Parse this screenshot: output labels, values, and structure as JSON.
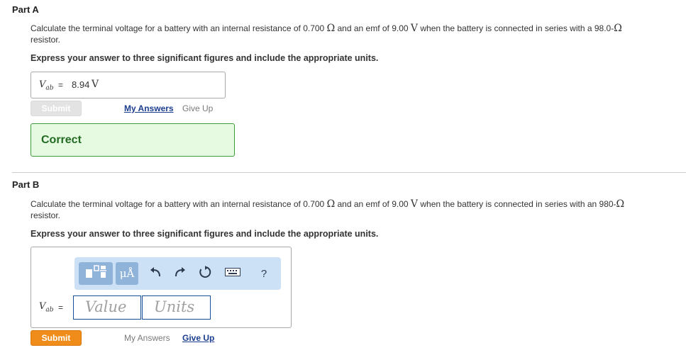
{
  "partA": {
    "title": "Part A",
    "question_pre": "Calculate the terminal voltage for a battery with an internal resistance of 0.700 ",
    "question_unit1": "Ω",
    "question_mid": " and an emf of 9.00 ",
    "question_unit2": "V",
    "question_post": " when the battery is connected in series with a 98.0-",
    "question_unit3": "Ω",
    "question_line2": "resistor.",
    "instruction": "Express your answer to three significant figures and include the appropriate units.",
    "variable": "V",
    "variable_sub": "ab",
    "equals": "=",
    "answer_value": "8.94",
    "answer_unit": "V",
    "submit_label": "Submit",
    "my_answers_label": "My Answers",
    "give_up_label": "Give Up",
    "feedback": "Correct"
  },
  "partB": {
    "title": "Part B",
    "question_pre": "Calculate the terminal voltage for a battery with an internal resistance of 0.700 ",
    "question_unit1": "Ω",
    "question_mid": " and an emf of 9.00 ",
    "question_unit2": "V",
    "question_post": " when the battery is connected in series with an 980-",
    "question_unit3": "Ω",
    "question_line2": "resistor.",
    "instruction": "Express your answer to three significant figures and include the appropriate units.",
    "toolbar": {
      "units_label": "μÅ",
      "help_label": "?"
    },
    "variable": "V",
    "variable_sub": "ab",
    "equals": "=",
    "value_placeholder": "Value",
    "units_placeholder": "Units",
    "submit_label": "Submit",
    "my_answers_label": "My Answers",
    "give_up_label": "Give Up"
  },
  "colors": {
    "submit_active": "#f08c1a",
    "correct_bg": "#e6f9e1",
    "correct_text": "#236b23",
    "link": "#1a3d8f",
    "toolbar_bg": "#cce0f6"
  }
}
